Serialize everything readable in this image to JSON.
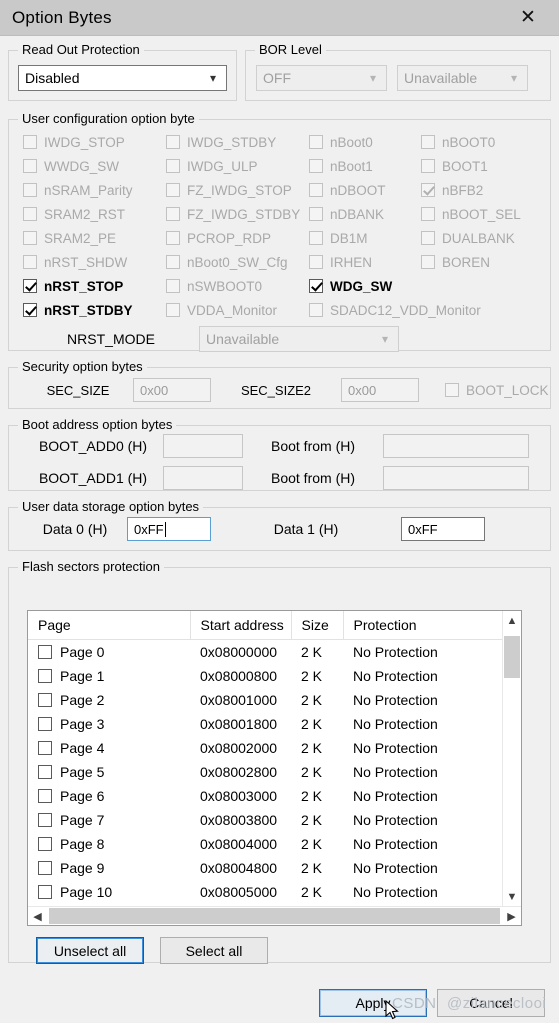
{
  "window": {
    "title": "Option Bytes",
    "close_icon": "close-icon"
  },
  "read_out_protection": {
    "legend": "Read Out Protection",
    "value": "Disabled"
  },
  "bor_level": {
    "legend": "BOR Level",
    "value_1": "OFF",
    "value_2": "Unavailable"
  },
  "user_configuration": {
    "legend": "User configuration option byte",
    "checkboxes": [
      {
        "label": "IWDG_STOP",
        "checked": false,
        "enabled": false
      },
      {
        "label": "IWDG_STDBY",
        "checked": false,
        "enabled": false
      },
      {
        "label": "nBoot0",
        "checked": false,
        "enabled": false
      },
      {
        "label": "nBOOT0",
        "checked": false,
        "enabled": false
      },
      {
        "label": "WWDG_SW",
        "checked": false,
        "enabled": false
      },
      {
        "label": "IWDG_ULP",
        "checked": false,
        "enabled": false
      },
      {
        "label": "nBoot1",
        "checked": false,
        "enabled": false
      },
      {
        "label": "BOOT1",
        "checked": false,
        "enabled": false
      },
      {
        "label": "nSRAM_Parity",
        "checked": false,
        "enabled": false
      },
      {
        "label": "FZ_IWDG_STOP",
        "checked": false,
        "enabled": false
      },
      {
        "label": "nDBOOT",
        "checked": false,
        "enabled": false
      },
      {
        "label": "nBFB2",
        "checked": true,
        "enabled": false
      },
      {
        "label": "SRAM2_RST",
        "checked": false,
        "enabled": false
      },
      {
        "label": "FZ_IWDG_STDBY",
        "checked": false,
        "enabled": false
      },
      {
        "label": "nDBANK",
        "checked": false,
        "enabled": false
      },
      {
        "label": "nBOOT_SEL",
        "checked": false,
        "enabled": false
      },
      {
        "label": "SRAM2_PE",
        "checked": false,
        "enabled": false
      },
      {
        "label": "PCROP_RDP",
        "checked": false,
        "enabled": false
      },
      {
        "label": "DB1M",
        "checked": false,
        "enabled": false
      },
      {
        "label": "DUALBANK",
        "checked": false,
        "enabled": false
      },
      {
        "label": "nRST_SHDW",
        "checked": false,
        "enabled": false
      },
      {
        "label": "nBoot0_SW_Cfg",
        "checked": false,
        "enabled": false
      },
      {
        "label": "IRHEN",
        "checked": false,
        "enabled": false
      },
      {
        "label": "BOREN",
        "checked": false,
        "enabled": false
      },
      {
        "label": "nRST_STOP",
        "checked": true,
        "enabled": true
      },
      {
        "label": "nSWBOOT0",
        "checked": false,
        "enabled": false
      },
      {
        "label": "WDG_SW",
        "checked": true,
        "enabled": true
      },
      {
        "label": "",
        "checked": false,
        "enabled": false
      },
      {
        "label": "nRST_STDBY",
        "checked": true,
        "enabled": true
      },
      {
        "label": "VDDA_Monitor",
        "checked": false,
        "enabled": false
      },
      {
        "label": "SDADC12_VDD_Monitor",
        "checked": false,
        "enabled": false
      },
      {
        "label": "",
        "checked": false,
        "enabled": false
      }
    ],
    "nrst_mode_label": "NRST_MODE",
    "nrst_mode_value": "Unavailable"
  },
  "security": {
    "legend": "Security option bytes",
    "sec_size_label": "SEC_SIZE",
    "sec_size_value": "0x00",
    "sec_size2_label": "SEC_SIZE2",
    "sec_size2_value": "0x00",
    "boot_lock_label": "BOOT_LOCK"
  },
  "boot_address": {
    "legend": "Boot address option bytes",
    "rows": [
      {
        "label": "BOOT_ADD0 (H)",
        "value": "",
        "from_label": "Boot from (H)",
        "from_value": ""
      },
      {
        "label": "BOOT_ADD1 (H)",
        "value": "",
        "from_label": "Boot from (H)",
        "from_value": ""
      }
    ]
  },
  "user_data": {
    "legend": "User data storage option bytes",
    "data0_label": "Data 0 (H)",
    "data0_value": "0xFF",
    "data1_label": "Data 1 (H)",
    "data1_value": "0xFF"
  },
  "flash_sectors": {
    "legend": "Flash sectors protection",
    "columns": [
      "Page",
      "Start address",
      "Size",
      "Protection"
    ],
    "rows": [
      {
        "page": "Page 0",
        "address": "0x08000000",
        "size": "2 K",
        "protection": "No Protection",
        "checked": false
      },
      {
        "page": "Page 1",
        "address": "0x08000800",
        "size": "2 K",
        "protection": "No Protection",
        "checked": false
      },
      {
        "page": "Page 2",
        "address": "0x08001000",
        "size": "2 K",
        "protection": "No Protection",
        "checked": false
      },
      {
        "page": "Page 3",
        "address": "0x08001800",
        "size": "2 K",
        "protection": "No Protection",
        "checked": false
      },
      {
        "page": "Page 4",
        "address": "0x08002000",
        "size": "2 K",
        "protection": "No Protection",
        "checked": false
      },
      {
        "page": "Page 5",
        "address": "0x08002800",
        "size": "2 K",
        "protection": "No Protection",
        "checked": false
      },
      {
        "page": "Page 6",
        "address": "0x08003000",
        "size": "2 K",
        "protection": "No Protection",
        "checked": false
      },
      {
        "page": "Page 7",
        "address": "0x08003800",
        "size": "2 K",
        "protection": "No Protection",
        "checked": false
      },
      {
        "page": "Page 8",
        "address": "0x08004000",
        "size": "2 K",
        "protection": "No Protection",
        "checked": false
      },
      {
        "page": "Page 9",
        "address": "0x08004800",
        "size": "2 K",
        "protection": "No Protection",
        "checked": false
      },
      {
        "page": "Page 10",
        "address": "0x08005000",
        "size": "2 K",
        "protection": "No Protection",
        "checked": false
      }
    ],
    "scroll_up_icon": "chevron-up-icon",
    "scroll_down_icon": "chevron-down-icon",
    "scroll_left_icon": "chevron-left-icon",
    "scroll_right_icon": "chevron-right-icon",
    "unselect_all_label": "Unselect all",
    "select_all_label": "Select all"
  },
  "actions": {
    "apply_label": "Apply",
    "cancel_label": "Cancel"
  },
  "watermark": {
    "text_1": "CSDN",
    "text_2": "@zilanceclooi"
  },
  "colors": {
    "titlebar": "#c9c9c9",
    "body": "#f0f0f0",
    "focus_blue": "#2a6fb5",
    "disabled_text": "#a9a9a9"
  }
}
